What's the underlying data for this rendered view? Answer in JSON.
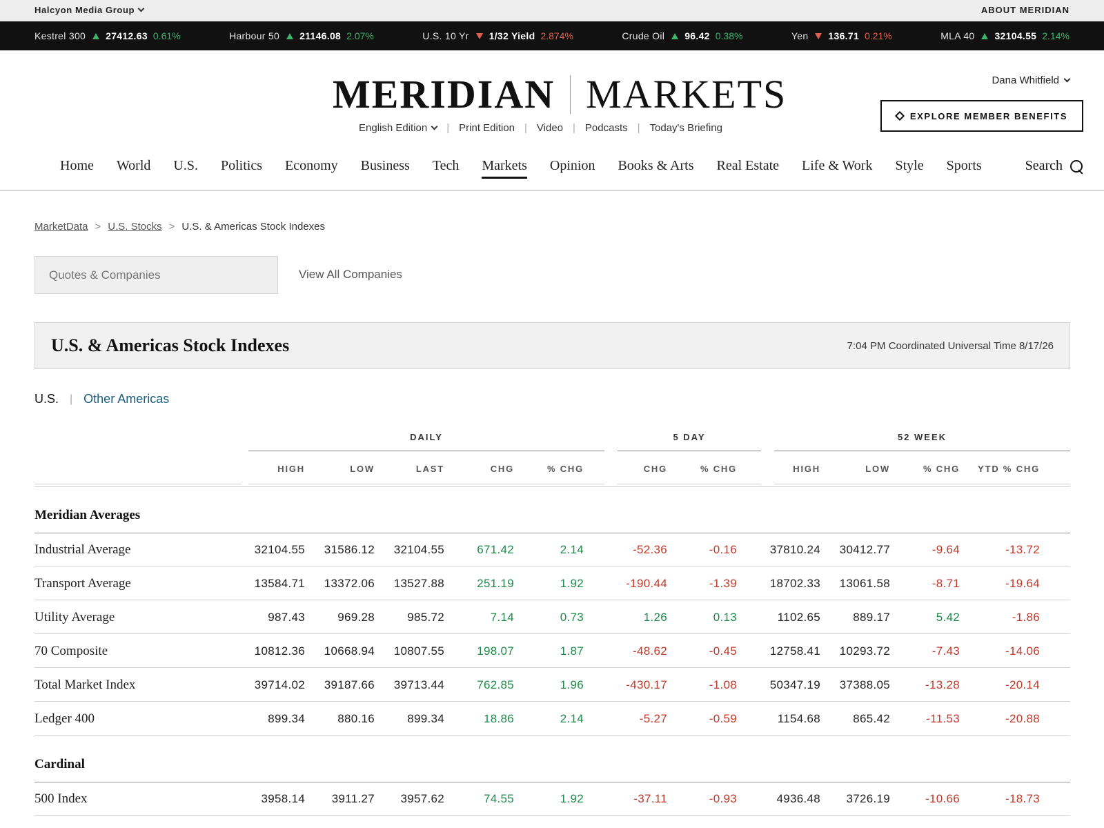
{
  "topbar": {
    "brand": "Halcyon Media Group",
    "about": "ABOUT MERIDIAN"
  },
  "ticker": [
    {
      "name": "Kestrel 300",
      "dir": "up",
      "value": "27412.63",
      "change": "0.61%"
    },
    {
      "name": "Harbour 50",
      "dir": "up",
      "value": "21146.08",
      "change": "2.07%"
    },
    {
      "name": "U.S. 10 Yr",
      "dir": "down",
      "value": "1/32 Yield",
      "change": "2.874%"
    },
    {
      "name": "Crude Oil",
      "dir": "up",
      "value": "96.42",
      "change": "0.38%"
    },
    {
      "name": "Yen",
      "dir": "down",
      "value": "136.71",
      "change": "0.21%"
    },
    {
      "name": "MLA 40",
      "dir": "up",
      "value": "32104.55",
      "change": "2.14%"
    }
  ],
  "masthead": {
    "logo_left": "MERIDIAN",
    "logo_right": "MARKETS",
    "editions": [
      "English Edition",
      "Print Edition",
      "Video",
      "Podcasts",
      "Today's Briefing"
    ],
    "user": "Dana Whitfield",
    "cta": "EXPLORE MEMBER BENEFITS"
  },
  "nav": {
    "items": [
      "Home",
      "World",
      "U.S.",
      "Politics",
      "Economy",
      "Business",
      "Tech",
      "Markets",
      "Opinion",
      "Books & Arts",
      "Real Estate",
      "Life & Work",
      "Style",
      "Sports"
    ],
    "active": "Markets",
    "search": "Search"
  },
  "breadcrumb": {
    "crumb1": "MarketData",
    "crumb2": "U.S. Stocks",
    "current": "U.S. & Americas Stock Indexes"
  },
  "search_row": {
    "placeholder": "Quotes & Companies",
    "view_all": "View All Companies"
  },
  "title": {
    "heading": "U.S. & Americas Stock Indexes",
    "timestamp": "7:04 PM Coordinated Universal Time 8/17/26"
  },
  "regions": {
    "active": "U.S.",
    "other": "Other Americas"
  },
  "table": {
    "groups": {
      "daily": "DAILY",
      "five_day": "5 DAY",
      "week52": "52 WEEK"
    },
    "columns": [
      "HIGH",
      "LOW",
      "LAST",
      "CHG",
      "% CHG",
      "CHG",
      "% CHG",
      "HIGH",
      "LOW",
      "% CHG",
      "YTD % CHG"
    ],
    "sections": [
      {
        "title": "Meridian Averages",
        "rows": [
          {
            "name": "Industrial Average",
            "values": [
              "32104.55",
              "31586.12",
              "32104.55",
              "671.42",
              "2.14",
              "-52.36",
              "-0.16",
              "37810.24",
              "30412.77",
              "-9.64",
              "-13.72"
            ]
          },
          {
            "name": "Transport Average",
            "values": [
              "13584.71",
              "13372.06",
              "13527.88",
              "251.19",
              "1.92",
              "-190.44",
              "-1.39",
              "18702.33",
              "13061.58",
              "-8.71",
              "-19.64"
            ]
          },
          {
            "name": "Utility Average",
            "values": [
              "987.43",
              "969.28",
              "985.72",
              "7.14",
              "0.73",
              "1.26",
              "0.13",
              "1102.65",
              "889.17",
              "5.42",
              "-1.86"
            ]
          },
          {
            "name": "70 Composite",
            "values": [
              "10812.36",
              "10668.94",
              "10807.55",
              "198.07",
              "1.87",
              "-48.62",
              "-0.45",
              "12758.41",
              "10293.72",
              "-7.43",
              "-14.06"
            ]
          },
          {
            "name": "Total Market Index",
            "values": [
              "39714.02",
              "39187.66",
              "39713.44",
              "762.85",
              "1.96",
              "-430.17",
              "-1.08",
              "50347.19",
              "37388.05",
              "-13.28",
              "-20.14"
            ]
          },
          {
            "name": "Ledger 400",
            "values": [
              "899.34",
              "880.16",
              "899.34",
              "18.86",
              "2.14",
              "-5.27",
              "-0.59",
              "1154.68",
              "865.42",
              "-11.53",
              "-20.88"
            ]
          }
        ]
      },
      {
        "title": "Cardinal",
        "rows": [
          {
            "name": "500 Index",
            "values": [
              "3958.14",
              "3911.27",
              "3957.62",
              "74.55",
              "1.92",
              "-37.11",
              "-0.93",
              "4936.48",
              "3726.19",
              "-10.66",
              "-18.73"
            ]
          }
        ]
      }
    ]
  },
  "colors": {
    "positive": "#1e8a4a",
    "negative": "#c0392b",
    "ticker_up": "#3fb36b",
    "ticker_down": "#e0604f"
  }
}
